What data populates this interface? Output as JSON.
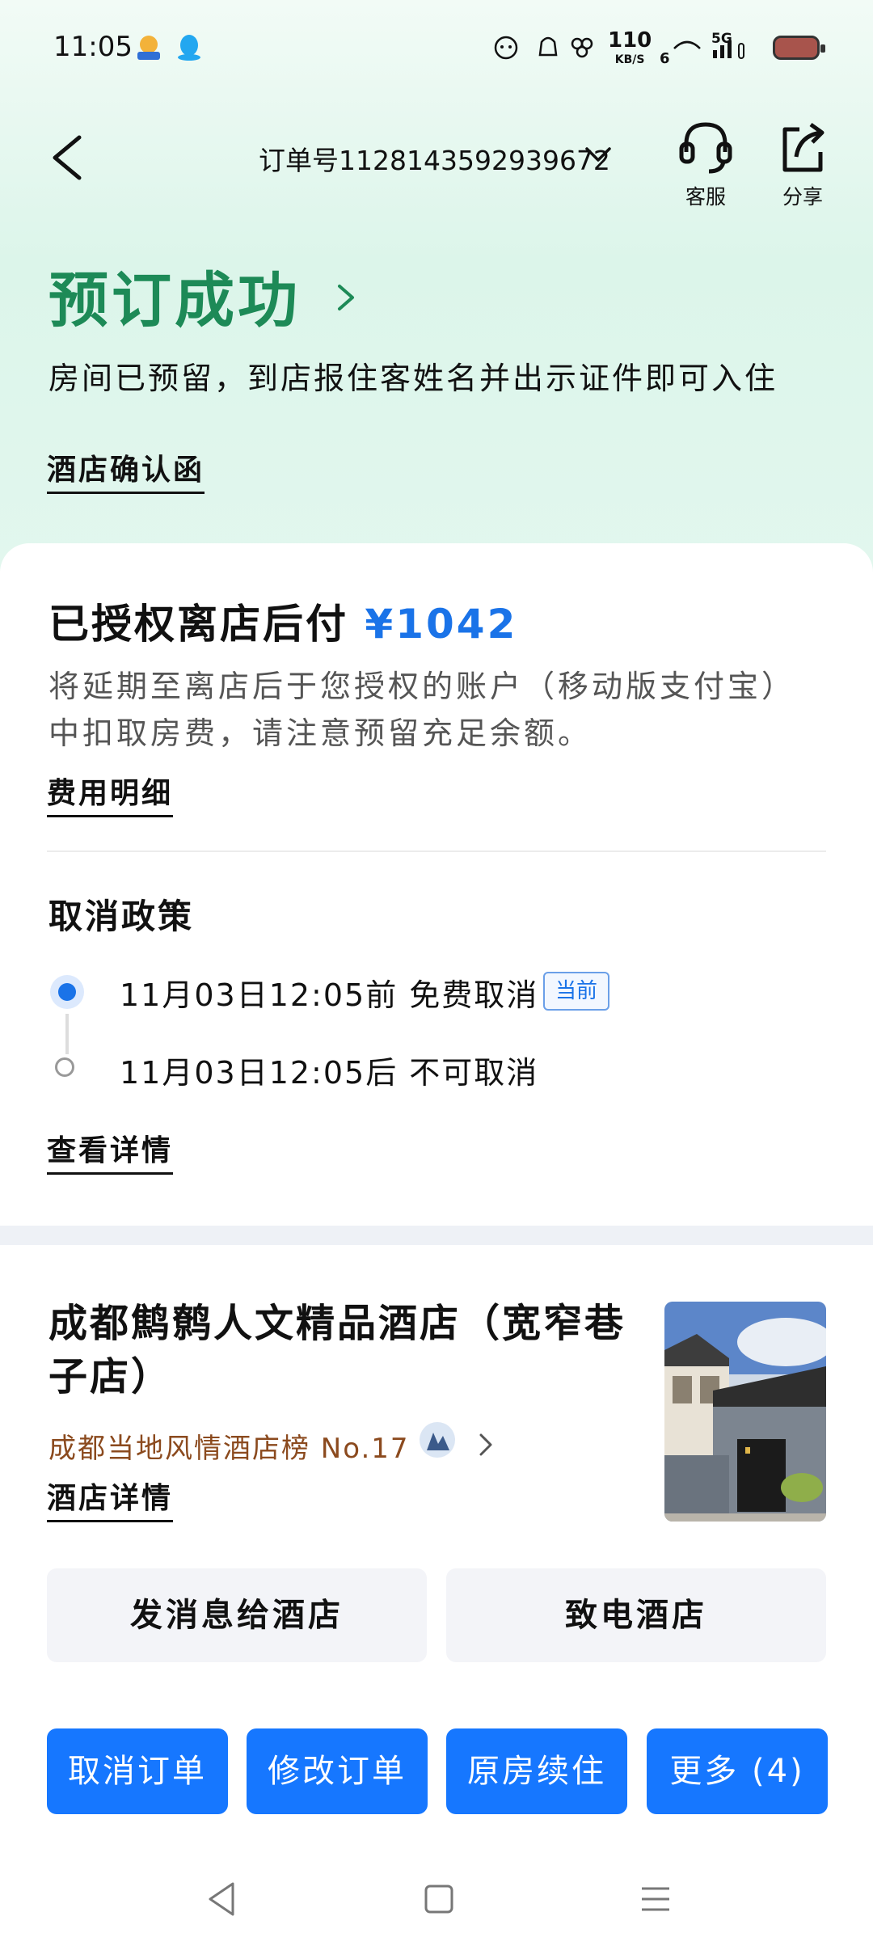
{
  "status_bar": {
    "time": "11:05",
    "net_speed": "110",
    "net_unit": "KB/S",
    "signal": "6",
    "network_type": "5G",
    "icons": [
      "app-badge-icon",
      "qq-penguin-icon",
      "cartoon-face-icon",
      "bell-cat-icon",
      "flower-icon",
      "signal-icon",
      "battery-icon"
    ]
  },
  "header": {
    "order_number": "订单号1128143592939672",
    "service_label": "客服",
    "share_label": "分享"
  },
  "success": {
    "title": "预订成功",
    "description": "房间已预留，到店报住客姓名并出示证件即可入住",
    "confirmation_link": "酒店确认函"
  },
  "payment": {
    "title": "已授权离店后付",
    "amount": "¥1042",
    "description": "将延期至离店后于您授权的账户（移动版支付宝）中扣取房费，请注意预留充足余额。",
    "details_link": "费用明细"
  },
  "cancel_policy": {
    "title": "取消政策",
    "rules": [
      {
        "text": "11月03日12:05前 免费取消",
        "badge": "当前",
        "active": true
      },
      {
        "text": "11月03日12:05后 不可取消",
        "active": false
      }
    ],
    "details_link": "查看详情"
  },
  "hotel": {
    "name": "成都鹪鹩人文精品酒店（宽窄巷子店）",
    "rank": "成都当地风情酒店榜 No.17",
    "details_link": "酒店详情",
    "message_button": "发消息给酒店",
    "call_button": "致电酒店"
  },
  "actions": {
    "cancel_order": "取消订单",
    "modify_order": "修改订单",
    "extend_stay": "原房续住",
    "more": "更多 (4)"
  },
  "colors": {
    "accent_blue": "#1677ff",
    "success_green": "#1d8a57",
    "rank_brown": "#8b4a1e"
  }
}
